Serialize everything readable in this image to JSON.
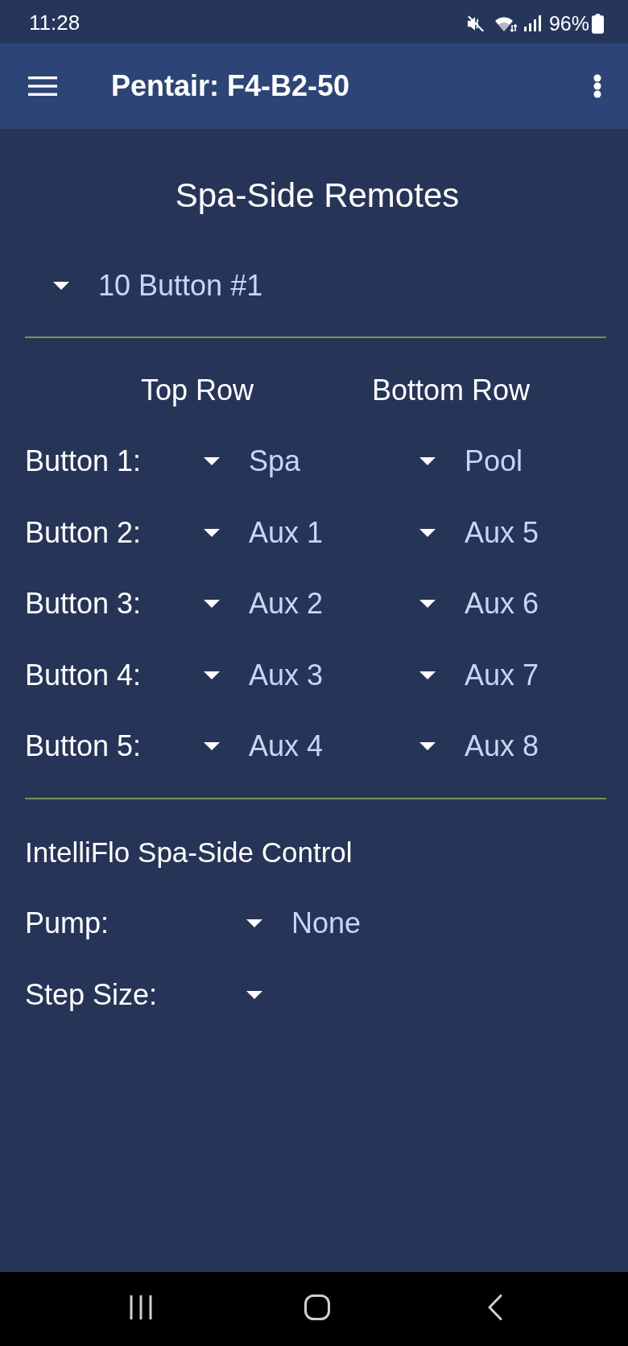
{
  "status_bar": {
    "time": "11:28",
    "battery": "96%"
  },
  "app_bar": {
    "title": "Pentair: F4-B2-50"
  },
  "page": {
    "title": "Spa-Side Remotes"
  },
  "remote_select": {
    "value": "10 Button #1"
  },
  "remote_buttons": {
    "columns": [
      "Top Row",
      "Bottom Row"
    ],
    "rows": [
      {
        "label": "Button 1:",
        "top": "Spa",
        "bottom": "Pool"
      },
      {
        "label": "Button 2:",
        "top": "Aux 1",
        "bottom": "Aux 5"
      },
      {
        "label": "Button 3:",
        "top": "Aux 2",
        "bottom": "Aux 6"
      },
      {
        "label": "Button 4:",
        "top": "Aux 3",
        "bottom": "Aux 7"
      },
      {
        "label": "Button 5:",
        "top": "Aux 4",
        "bottom": "Aux 8"
      }
    ]
  },
  "intelliflo": {
    "title": "IntelliFlo Spa-Side Control",
    "fields": [
      {
        "label": "Pump:",
        "value": "None"
      },
      {
        "label": "Step Size:"
      }
    ]
  }
}
